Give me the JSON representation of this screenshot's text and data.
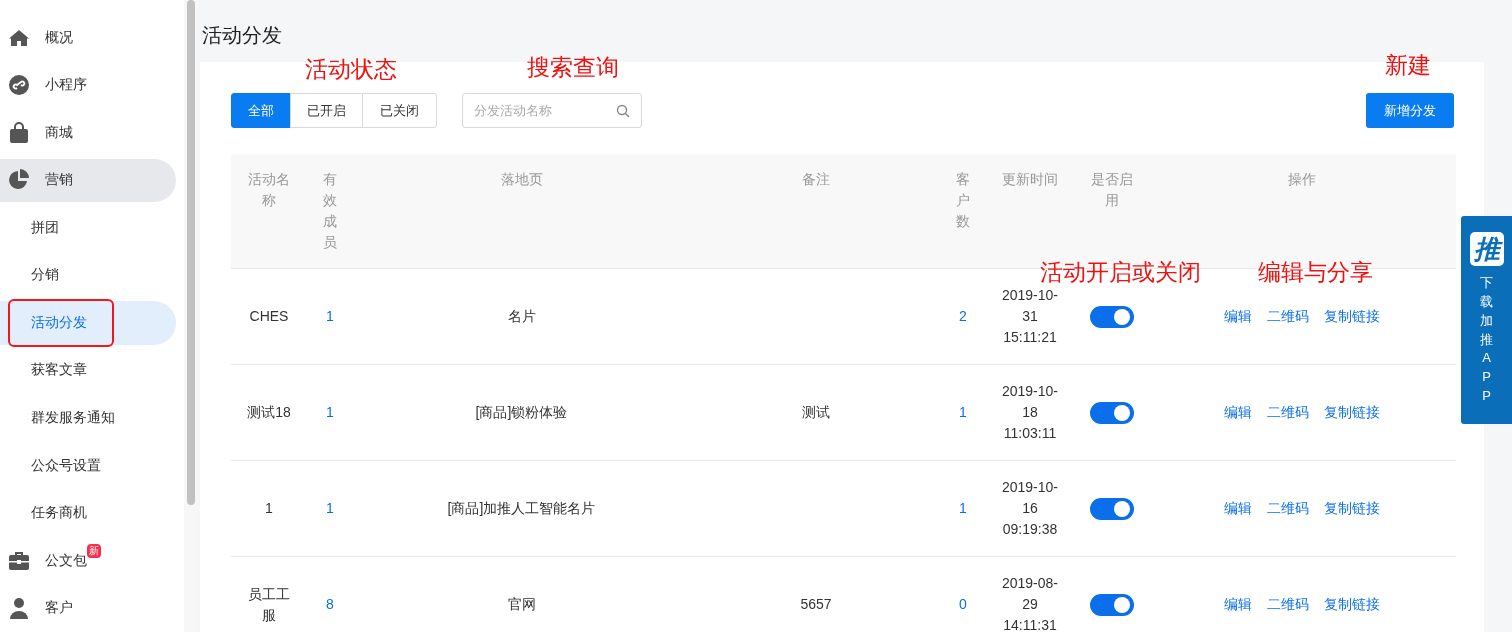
{
  "sidebar": {
    "items": [
      {
        "label": "概况",
        "selected": false
      },
      {
        "label": "小程序",
        "selected": false
      },
      {
        "label": "商城",
        "selected": false
      },
      {
        "label": "营销",
        "selected": false,
        "expanded": true,
        "children": [
          {
            "label": "拼团",
            "selected": false,
            "outlined": false
          },
          {
            "label": "分销",
            "selected": false,
            "outlined": false
          },
          {
            "label": "活动分发",
            "selected": true,
            "outlined": true
          },
          {
            "label": "获客文章",
            "selected": false,
            "outlined": false
          },
          {
            "label": "群发服务通知",
            "selected": false,
            "outlined": false
          },
          {
            "label": "公众号设置",
            "selected": false,
            "outlined": false
          },
          {
            "label": "任务商机",
            "selected": false,
            "outlined": false
          }
        ]
      },
      {
        "label": "公文包",
        "selected": false,
        "badge": "新"
      },
      {
        "label": "客户",
        "selected": false
      }
    ]
  },
  "page_title": "活动分发",
  "status_filter": [
    {
      "label": "全部",
      "selected": true
    },
    {
      "label": "已开启",
      "selected": false
    },
    {
      "label": "已关闭",
      "selected": false
    }
  ],
  "search": {
    "placeholder": "分发活动名称"
  },
  "new_button": "新增分发",
  "table": {
    "columns": [
      "活动名称",
      "有效成员",
      "落地页",
      "备注",
      "客户数",
      "更新时间",
      "是否启用",
      "操作"
    ],
    "rows": [
      {
        "name": "CHES",
        "members": "1",
        "landing_page": "名片",
        "note": "",
        "customers": "2",
        "updated": "2019-10-31 15:11:21",
        "enabled": true,
        "actions": [
          "编辑",
          "二维码",
          "复制链接"
        ]
      },
      {
        "name": "测试18",
        "members": "1",
        "landing_page": "[商品]锁粉体验",
        "note": "测试",
        "customers": "1",
        "updated": "2019-10-18 11:03:11",
        "enabled": true,
        "actions": [
          "编辑",
          "二维码",
          "复制链接"
        ]
      },
      {
        "name": "1",
        "members": "1",
        "landing_page": "[商品]加推人工智能名片",
        "note": "",
        "customers": "1",
        "updated": "2019-10-16 09:19:38",
        "enabled": true,
        "actions": [
          "编辑",
          "二维码",
          "复制链接"
        ]
      },
      {
        "name": "员工工服",
        "members": "8",
        "landing_page": "官网",
        "note": "5657",
        "customers": "0",
        "updated": "2019-08-29 14:11:31",
        "enabled": true,
        "actions": [
          "编辑",
          "二维码",
          "复制链接"
        ]
      }
    ]
  },
  "side_panel": {
    "logo": "推",
    "text": "下载加推APP"
  },
  "annotations": [
    "活动状态",
    "搜索查询",
    "新建",
    "活动开启或关闭",
    "编辑与分享"
  ]
}
